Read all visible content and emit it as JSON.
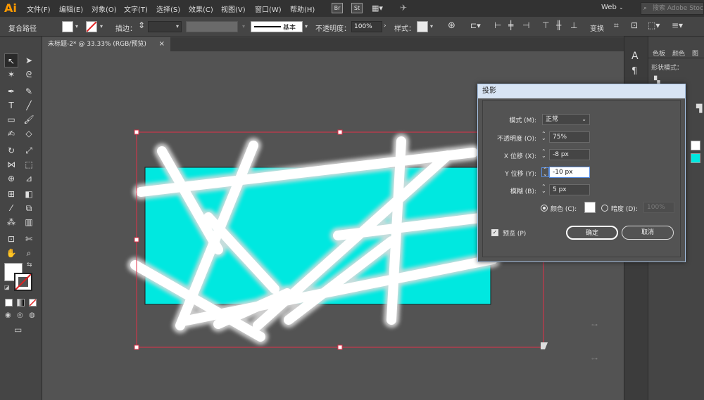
{
  "app": {
    "logo": "Ai"
  },
  "menu": {
    "items": [
      "文件(F)",
      "编辑(E)",
      "对象(O)",
      "文字(T)",
      "选择(S)",
      "效果(C)",
      "视图(V)",
      "窗口(W)",
      "帮助(H)"
    ],
    "bridge_label": "Br",
    "stock_label": "St",
    "workspace": "Web",
    "search_placeholder": "搜索 Adobe Stock"
  },
  "control": {
    "selection_type": "复合路径",
    "stroke_label": "描边：",
    "stroke_style": "基本",
    "opacity_label": "不透明度：",
    "opacity_value": "100%",
    "style_label": "样式：",
    "transform_label": "变换"
  },
  "document": {
    "tab_title": "未标题-2* @ 33.33% (RGB/预览)",
    "close": "×"
  },
  "panels": {
    "tabs": [
      "色板",
      "颜色",
      "图"
    ],
    "shape_mode_label": "形状模式："
  },
  "dialog": {
    "title": "投影",
    "mode_label": "模式 (M):",
    "mode_value": "正常",
    "opacity_label": "不透明度 (O):",
    "opacity_value": "75%",
    "x_offset_label": "X 位移 (X):",
    "x_offset_value": "-8 px",
    "y_offset_label": "Y 位移 (Y):",
    "y_offset_value": "-10 px",
    "blur_label": "模糊 (B):",
    "blur_value": "5 px",
    "color_label": "颜色 (C):",
    "darkness_label": "暗度 (D):",
    "darkness_value": "100%",
    "preview_label": "预览 (P)",
    "ok_label": "确定",
    "cancel_label": "取消"
  },
  "colors": {
    "accent": "#ff9a00",
    "artwork_fill": "#00e8e0",
    "selection": "#e0304a",
    "shadow_color": "#ffffff"
  }
}
